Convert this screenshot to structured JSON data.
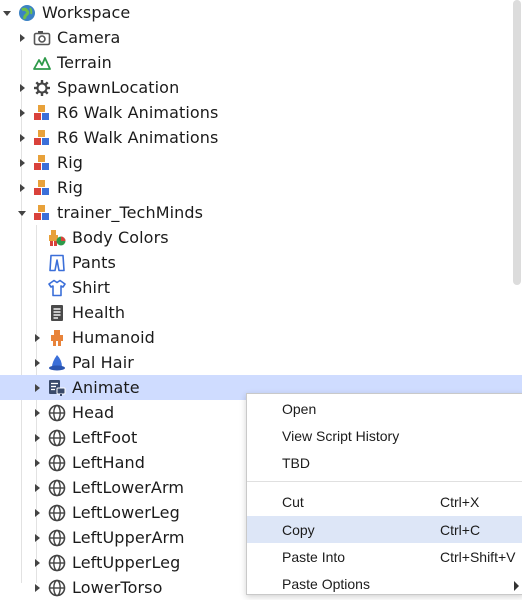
{
  "tree": {
    "nodes": [
      {
        "label": "Workspace",
        "icon": "workspace-globe-icon",
        "expanded": true
      },
      {
        "label": "Camera",
        "icon": "camera-icon"
      },
      {
        "label": "Terrain",
        "icon": "terrain-icon"
      },
      {
        "label": "SpawnLocation",
        "icon": "spawn-gear-icon"
      },
      {
        "label": "R6 Walk Animations",
        "icon": "model-blocks-icon"
      },
      {
        "label": "R6 Walk Animations",
        "icon": "model-blocks-icon"
      },
      {
        "label": "Rig",
        "icon": "model-blocks-icon"
      },
      {
        "label": "Rig",
        "icon": "model-blocks-icon"
      },
      {
        "label": "trainer_TechMinds",
        "icon": "model-blocks-icon",
        "expanded": true
      },
      {
        "label": "Body Colors",
        "icon": "body-colors-icon"
      },
      {
        "label": "Pants",
        "icon": "pants-icon"
      },
      {
        "label": "Shirt",
        "icon": "shirt-icon"
      },
      {
        "label": "Health",
        "icon": "script-icon"
      },
      {
        "label": "Humanoid",
        "icon": "humanoid-icon"
      },
      {
        "label": "Pal Hair",
        "icon": "hat-icon"
      },
      {
        "label": "Animate",
        "icon": "local-script-icon",
        "selected": true
      },
      {
        "label": "Head",
        "icon": "part-globe-icon"
      },
      {
        "label": "LeftFoot",
        "icon": "part-globe-icon"
      },
      {
        "label": "LeftHand",
        "icon": "part-globe-icon"
      },
      {
        "label": "LeftLowerArm",
        "icon": "part-globe-icon"
      },
      {
        "label": "LeftLowerLeg",
        "icon": "part-globe-icon"
      },
      {
        "label": "LeftUpperArm",
        "icon": "part-globe-icon"
      },
      {
        "label": "LeftUpperLeg",
        "icon": "part-globe-icon"
      },
      {
        "label": "LowerTorso",
        "icon": "part-globe-icon"
      }
    ]
  },
  "context_menu": {
    "items": [
      {
        "label": "Open",
        "shortcut": ""
      },
      {
        "label": "View Script History",
        "shortcut": ""
      },
      {
        "label": "TBD",
        "shortcut": ""
      },
      {
        "label": "Cut",
        "shortcut": "Ctrl+X"
      },
      {
        "label": "Copy",
        "shortcut": "Ctrl+C",
        "hovered": true
      },
      {
        "label": "Paste Into",
        "shortcut": "Ctrl+Shift+V"
      },
      {
        "label": "Paste Options",
        "shortcut": "",
        "submenu": true
      }
    ]
  },
  "colors": {
    "selection": "#cfdcff",
    "menu_hover": "#dde6f7"
  }
}
